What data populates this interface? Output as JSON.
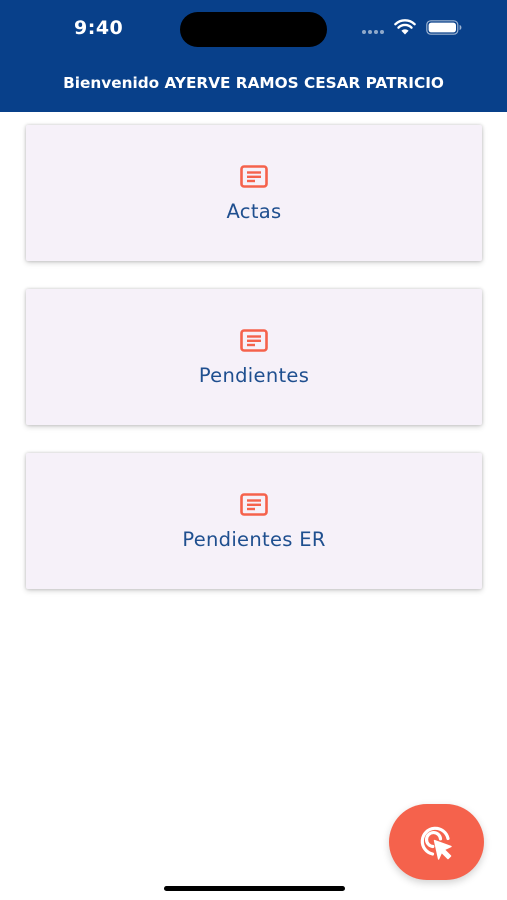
{
  "status_bar": {
    "time": "9:40"
  },
  "header": {
    "title": "Bienvenido AYERVE RAMOS CESAR PATRICIO"
  },
  "menu": {
    "items": [
      {
        "label": "Actas",
        "icon": "document-icon"
      },
      {
        "label": "Pendientes",
        "icon": "document-icon"
      },
      {
        "label": "Pendientes ER",
        "icon": "document-icon"
      }
    ]
  },
  "fab": {
    "icon": "tap-cursor-icon"
  },
  "colors": {
    "header_bg": "#08408a",
    "card_bg": "#f6f1f9",
    "accent": "#f5624c",
    "label_text": "#1f4f8f"
  }
}
